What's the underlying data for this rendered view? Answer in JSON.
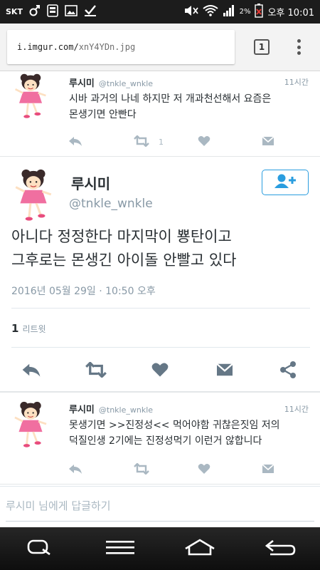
{
  "status_bar": {
    "carrier": "SKT",
    "battery": "2%",
    "time": "오후 10:01"
  },
  "browser": {
    "url_host": "i.imgur.com/",
    "url_path": "xnY4YDn.jpg",
    "tab_count": "1"
  },
  "tweet_above": {
    "name": "루시미",
    "handle": "@tnkle_wnkle",
    "time": "11시간",
    "text_line1": "시바 과거의 나네 하지만 저 개과천선해서 요즘은",
    "text_line2": "몬생기면 안빤다",
    "retweet_count": "1"
  },
  "main_tweet": {
    "name": "루시미",
    "handle": "@tnkle_wnkle",
    "text_line1": "아니다 정정한다 마지막이 뿅탄이고",
    "text_line2": "그후로는 몬생긴 아이돌 안빨고 있다",
    "date": "2016년 05월 29일 · 10:50 오후",
    "retweet_number": "1",
    "retweet_label": "리트윗"
  },
  "tweet_below": {
    "name": "루시미",
    "handle": "@tnkle_wnkle",
    "time": "11시간",
    "text_line1": "못생기면 >>진정성<< 먹어야함 귀찮은짓임 저의",
    "text_line2": "덕질인생 2기에는 진정성먹기 이런거 않합니다"
  },
  "reply": {
    "placeholder": "루시미 님에게 답글하기"
  },
  "colors": {
    "accent": "#2a9ddf",
    "muted": "#8899a6",
    "icon": "#aab8c2",
    "text": "#292f33"
  }
}
